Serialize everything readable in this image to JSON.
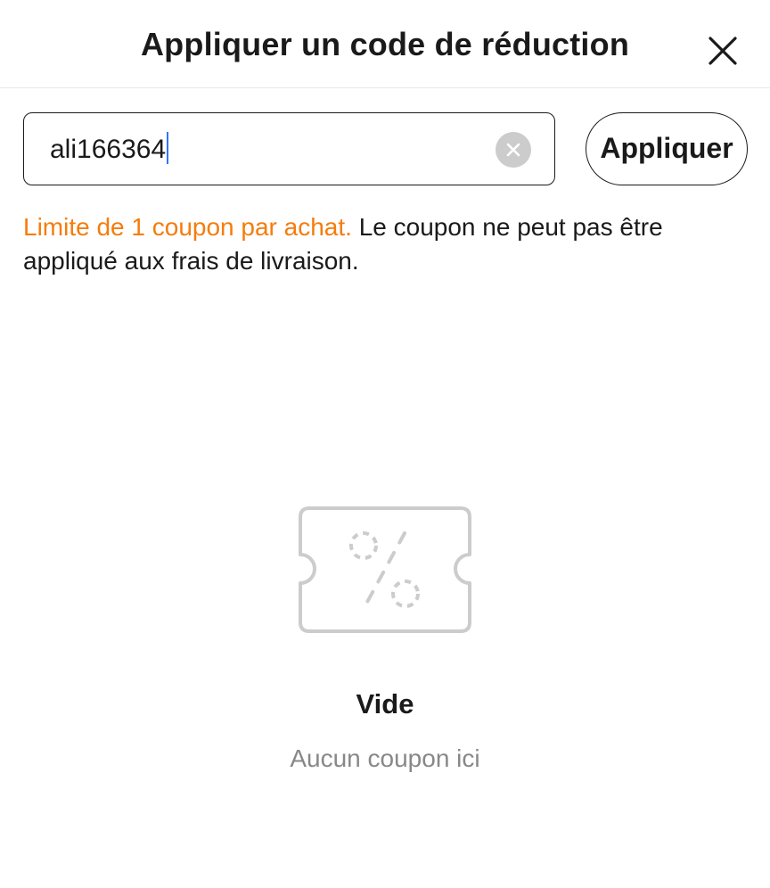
{
  "dialog": {
    "title": "Appliquer un code de réduction",
    "close_icon": "close-icon"
  },
  "coupon_form": {
    "input_value": "ali166364",
    "clear_icon": "clear-circle-icon",
    "apply_label": "Appliquer"
  },
  "notice": {
    "warning": "Limite de 1 coupon par achat.",
    "info": " Le coupon ne peut pas être appliqué aux frais de livraison."
  },
  "empty_state": {
    "icon": "coupon-ticket-icon",
    "title": "Vide",
    "subtitle": "Aucun coupon ici"
  },
  "colors": {
    "warning": "#f57c0b",
    "text": "#1a1a1a",
    "muted": "#888888",
    "caret": "#2f73ff",
    "icon_gray": "#cccccc"
  }
}
